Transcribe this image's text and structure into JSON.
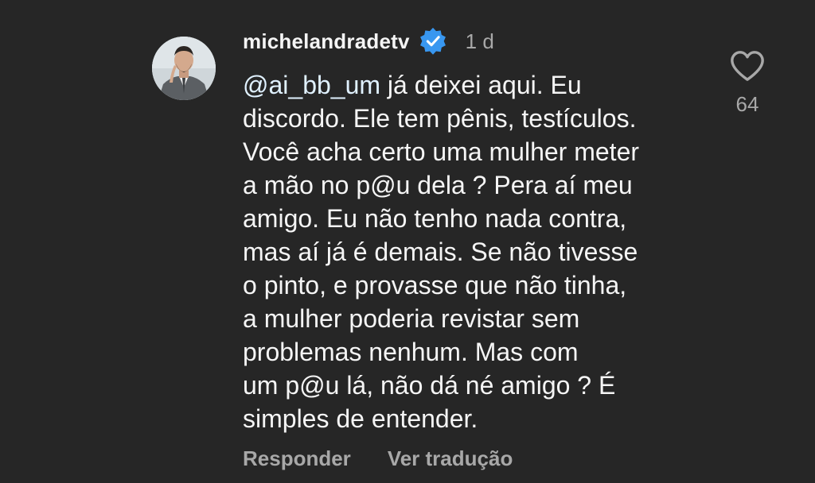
{
  "comment": {
    "username": "michelandradetv",
    "verified": true,
    "time": "1 d",
    "mention": "@ai_bb_um",
    "lines": [
      " já deixei aqui. Eu",
      "discordo. Ele tem pênis, testículos.",
      "Você acha certo uma mulher meter",
      "a mão no p@u dela ? Pera aí meu",
      "amigo. Eu não tenho nada contra,",
      "mas aí já é demais. Se não tivesse",
      "o pinto, e provasse que não tinha,",
      "a mulher poderia revistar sem",
      "problemas nenhum. Mas com",
      "um p@u lá, não dá né amigo ? É",
      "simples de entender."
    ],
    "likes": "64"
  },
  "actions": {
    "reply_label": "Responder",
    "translate_label": "Ver tradução"
  },
  "icons": {
    "avatar": "profile-photo",
    "verified": "verified-badge-icon",
    "like": "heart-icon"
  },
  "colors": {
    "background": "#262626",
    "text": "#f5f5f5",
    "secondary_text": "#a8a8a8",
    "verified_badge": "#3897f0"
  }
}
